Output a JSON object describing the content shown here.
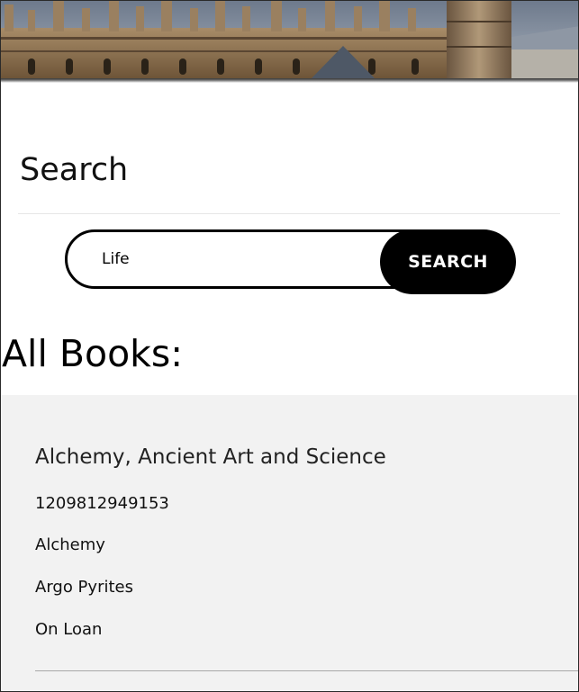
{
  "search": {
    "heading": "Search",
    "query": "Life",
    "button_label": "SEARCH"
  },
  "books": {
    "heading": "All Books:",
    "items": [
      {
        "title": "Alchemy, Ancient Art and Science",
        "isbn": "1209812949153",
        "subject": "Alchemy",
        "author": "Argo Pyrites",
        "status": "On Loan"
      }
    ]
  },
  "colors": {
    "button_bg": "#000000",
    "button_text": "#ffffff",
    "panel_bg": "#f2f2f2",
    "banner_sky": "#8a96a6",
    "banner_stone": "#8c6f4c"
  }
}
